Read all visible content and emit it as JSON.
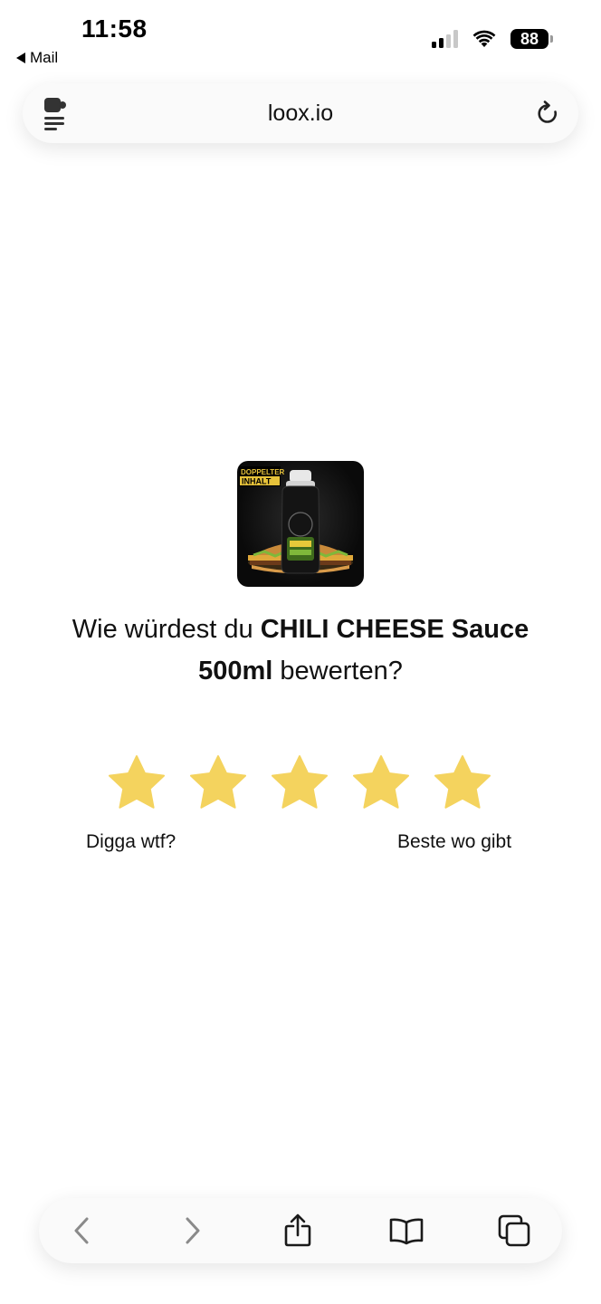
{
  "status_bar": {
    "time": "11:58",
    "back_app": "Mail",
    "battery_level": "88",
    "signal_bars_filled": 2,
    "signal_bars_total": 4
  },
  "browser": {
    "url": "loox.io",
    "icons": {
      "page_menu": "page-menu-icon",
      "reload": "reload-icon"
    }
  },
  "review": {
    "product_image_alt": "CHILI CHEESE Sauce 500ml",
    "badge_line1": "DOPPELTER",
    "badge_line2": "INHALT",
    "question_prefix": "Wie würdest du ",
    "product_name": "CHILI CHEESE Sauce 500ml",
    "question_suffix": " bewerten?",
    "star_count": 5,
    "star_color": "#F4D35E",
    "label_low": "Digga wtf?",
    "label_high": "Beste wo gibt"
  },
  "toolbar": {
    "icons": [
      "back-icon",
      "forward-icon",
      "share-icon",
      "bookmarks-icon",
      "tabs-icon"
    ]
  }
}
